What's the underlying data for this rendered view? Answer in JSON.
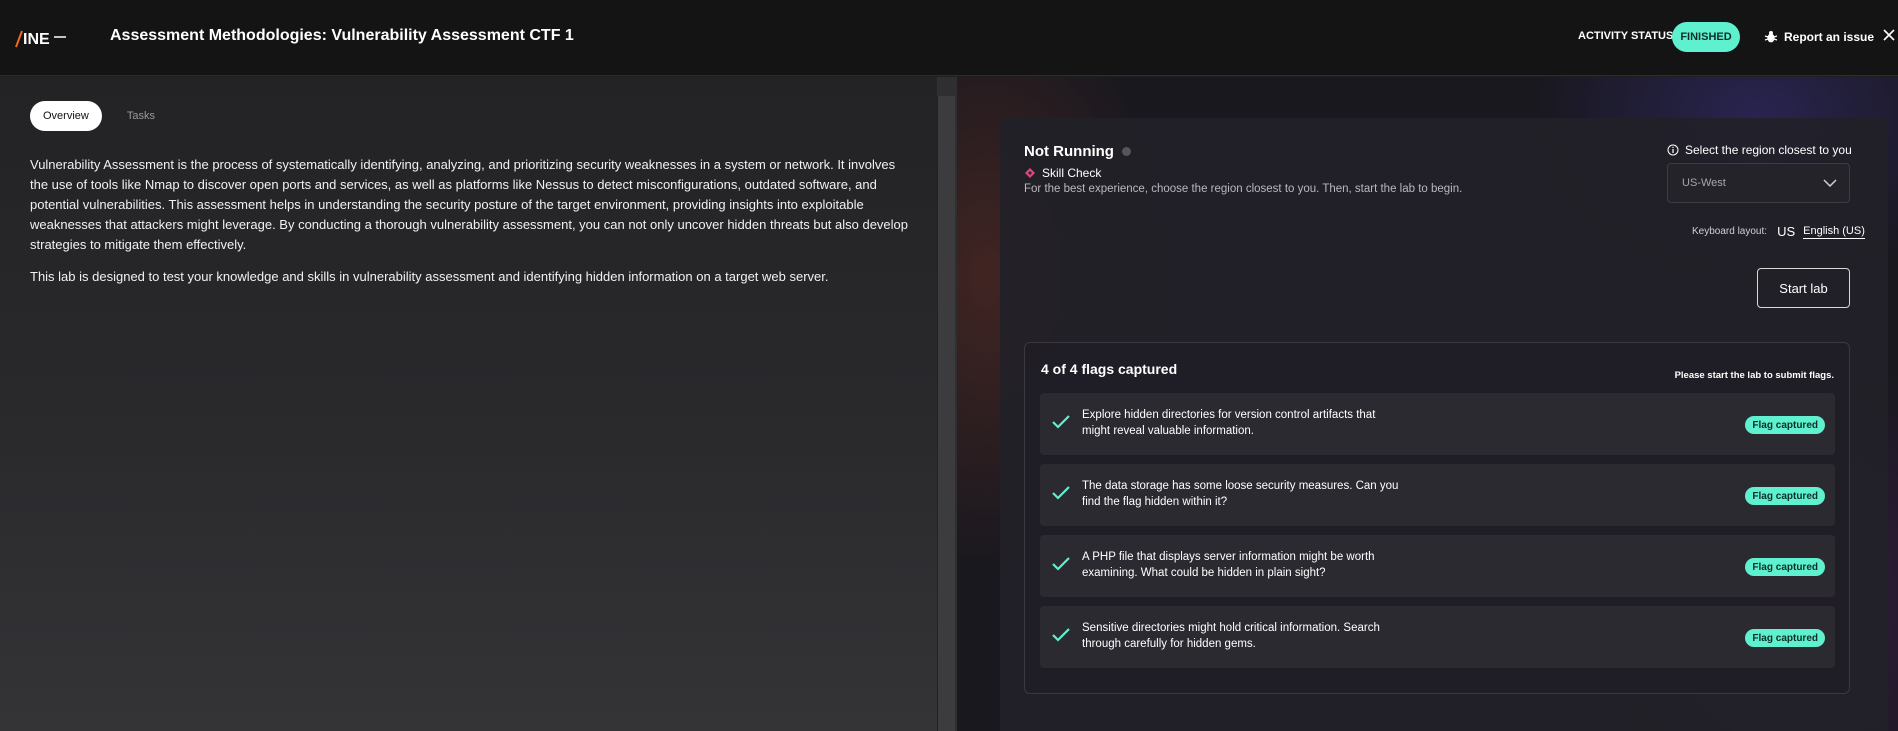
{
  "header": {
    "logo_text": "INE",
    "title": "Assessment Methodologies: Vulnerability Assessment CTF 1",
    "activity_label": "ACTIVITY STATUS:",
    "activity_status": "FINISHED",
    "report_label": "Report an issue",
    "accent_color": "#5ff0cf"
  },
  "left": {
    "tabs": [
      {
        "label": "Overview",
        "active": true
      },
      {
        "label": "Tasks",
        "active": false
      }
    ],
    "paragraphs": [
      "Vulnerability Assessment is the process of systematically identifying, analyzing, and prioritizing security weaknesses in a system or network. It involves the use of tools like Nmap to discover open ports and services, as well as platforms like Nessus to detect misconfigurations, outdated software, and potential vulnerabilities. This assessment helps in understanding the security posture of the target environment, providing insights into exploitable weaknesses that attackers might leverage. By conducting a thorough vulnerability assessment, you can not only uncover hidden threats but also develop strategies to mitigate them effectively.",
      "This lab is designed to test your knowledge and skills in vulnerability assessment and identifying hidden information on a target web server."
    ]
  },
  "lab": {
    "status": "Not Running",
    "type": "Skill Check",
    "hint": "For the best experience, choose the region closest to you. Then, start the lab to begin.",
    "region_label": "Select the region closest to you",
    "region_value": "US-West",
    "keyboard_label": "Keyboard layout:",
    "keyboard_code": "US",
    "keyboard_value": "English (US)",
    "start_label": "Start lab"
  },
  "flags": {
    "summary": "4 of 4 flags captured",
    "note": "Please start the lab to submit flags.",
    "items": [
      {
        "text": "Explore hidden directories for version control artifacts that might reveal valuable information.",
        "status": "Flag captured"
      },
      {
        "text": "The data storage has some loose security measures. Can you find the flag hidden within it?",
        "status": "Flag captured"
      },
      {
        "text": "A PHP file that displays server information might be worth examining. What could be hidden in plain sight?",
        "status": "Flag captured"
      },
      {
        "text": "Sensitive directories might hold critical information. Search through carefully for hidden gems.",
        "status": "Flag captured"
      }
    ]
  }
}
